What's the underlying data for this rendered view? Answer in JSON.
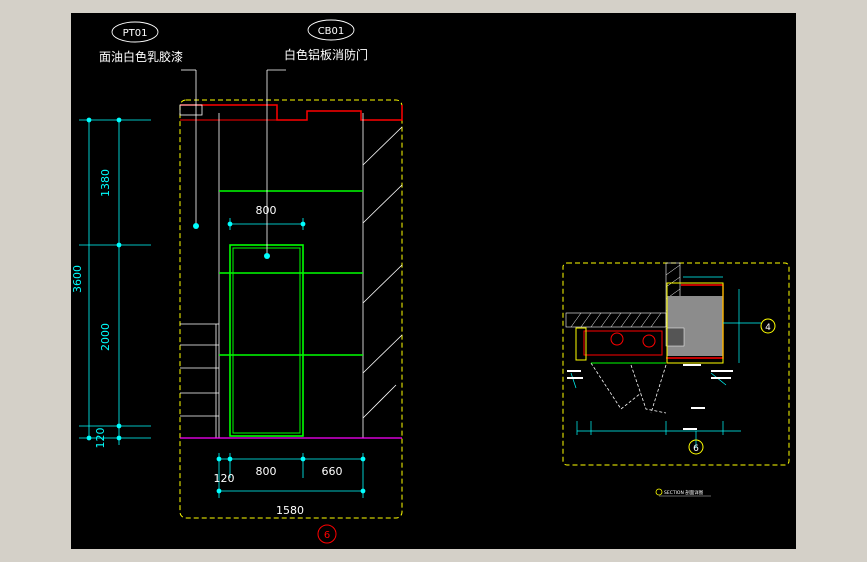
{
  "window": {
    "background": "#d4d0c8",
    "canvas_background": "#000000"
  },
  "elevation": {
    "tag_left": "PT01",
    "tag_right": "CB01",
    "note_left": "面油白色乳胶漆",
    "note_right": "白色铝板消防门",
    "dim_total_height": "3600",
    "dim_upper": "1380",
    "dim_middle": "2000",
    "dim_bottom": "120",
    "dim_door_width_top": "800",
    "dim_left_gap": "120",
    "dim_door_width": "800",
    "dim_right_width": "660",
    "dim_total_width": "1580",
    "elevation_marker": "6"
  },
  "plan": {
    "marker_right": "4",
    "marker_bottom": "6",
    "caption": "SECTION 剖面详图"
  },
  "colors": {
    "dimension": "#00ffff",
    "boundary": "#ffff00",
    "door": "#00ff00",
    "wall_section": "#ff0000",
    "linework": "#ffffff",
    "floor": "#ff00ff",
    "fill_gray": "#8c8c8c"
  }
}
